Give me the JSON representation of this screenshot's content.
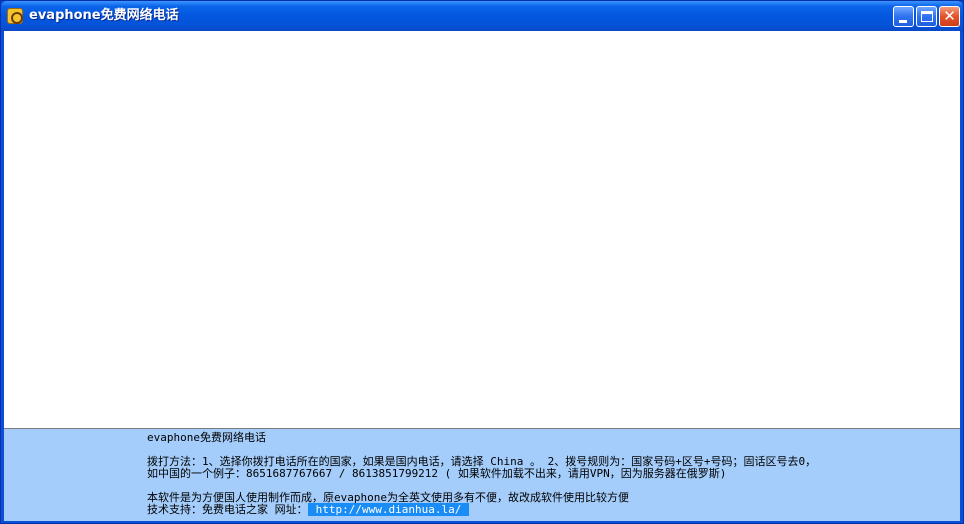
{
  "window": {
    "title": "evaphone免费网络电话"
  },
  "titlebar_buttons": {
    "minimize": "minimize",
    "maximize": "maximize",
    "close": "✕"
  },
  "footer": {
    "app_name": "evaphone免费网络电话",
    "instructions_line1": "拨打方法：1、选择你拨打电话所在的国家，如果是国内电话，请选择 China 。 2、拨号规则为：国家号码+区号+号码；固话区号去0，",
    "instructions_line2": "如中国的一个例子：8651687767667 / 8613851799212 ( 如果软件加载不出来，请用VPN，因为服务器在俄罗斯)",
    "about": "本软件是为方便国人使用制作而成，原evaphone为全英文使用多有不便，故改成软件使用比较方便",
    "support_label": "技术支持：免费电话之家 网址：",
    "support_url": "http://www.dianhua.la/"
  }
}
